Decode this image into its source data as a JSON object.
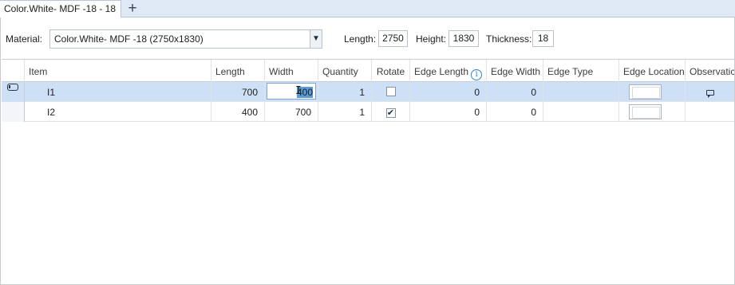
{
  "tabs": [
    {
      "label": "Color.White- MDF -18 - 18"
    }
  ],
  "tab_add_label": "+",
  "toolbar": {
    "material_label": "Material:",
    "material_value": "Color.White- MDF -18 (2750x1830)",
    "length_label": "Length:",
    "length_value": "2750",
    "height_label": "Height:",
    "height_value": "1830",
    "thickness_label": "Thickness:",
    "thickness_value": "18"
  },
  "grid": {
    "columns": [
      "Item",
      "Length",
      "Width",
      "Quantity",
      "Rotate",
      "Edge Length",
      "Edge Width",
      "Edge Type",
      "Edge Location",
      "Observatic"
    ],
    "rows": [
      {
        "item": "I1",
        "length": "700",
        "width_prefix": "",
        "width_selected": "400",
        "quantity": "1",
        "rotate": false,
        "edge_length": "0",
        "edge_width": "0",
        "edge_type": ""
      },
      {
        "item": "I2",
        "length": "400",
        "width": "700",
        "quantity": "1",
        "rotate": true,
        "edge_length": "0",
        "edge_width": "0",
        "edge_type": ""
      }
    ]
  },
  "icons": {
    "tab_add": "plus-icon",
    "dropdown": "double-chevron-down-icon",
    "info": "info-icon",
    "row_indicator": "record-indicator-icon",
    "observation": "comment-icon",
    "checkmark": "✔"
  }
}
